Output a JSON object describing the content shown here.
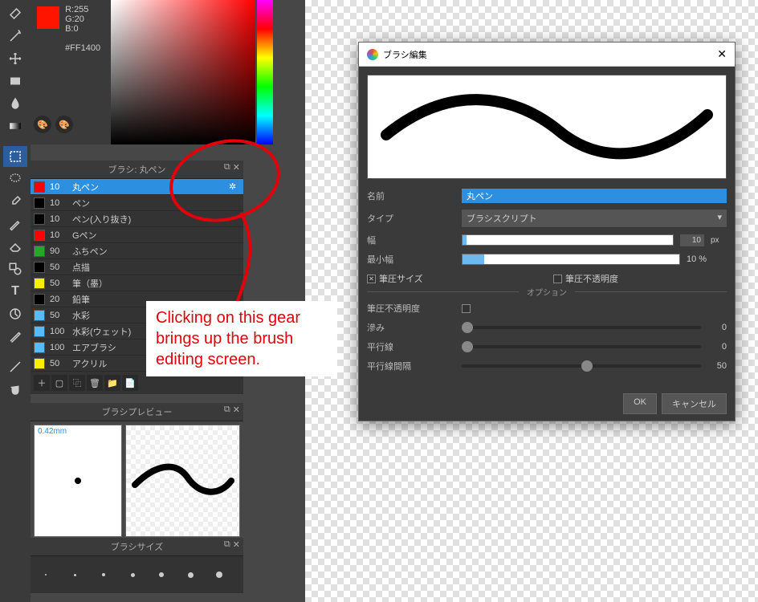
{
  "color": {
    "r": "R:255",
    "g": "G:20",
    "b": "B:0",
    "hex": "#FF1400"
  },
  "brush_panel": {
    "title": "ブラシ: 丸ペン",
    "items": [
      {
        "color": "#ff0000",
        "size": "10",
        "name": "丸ペン",
        "selected": true
      },
      {
        "color": "#000000",
        "size": "10",
        "name": "ペン"
      },
      {
        "color": "#000000",
        "size": "10",
        "name": "ペン(入り抜き)"
      },
      {
        "color": "#ff0000",
        "size": "10",
        "name": "Gペン"
      },
      {
        "color": "#22aa22",
        "size": "90",
        "name": "ふちペン"
      },
      {
        "color": "#000000",
        "size": "50",
        "name": "点描"
      },
      {
        "color": "#ffee00",
        "size": "50",
        "name": "筆（墨）"
      },
      {
        "color": "#000000",
        "size": "20",
        "name": "鉛筆"
      },
      {
        "color": "#55bbff",
        "size": "50",
        "name": "水彩"
      },
      {
        "color": "#55bbff",
        "size": "100",
        "name": "水彩(ウェット)"
      },
      {
        "color": "#55bbff",
        "size": "100",
        "name": "エアブラシ"
      },
      {
        "color": "#ffee00",
        "size": "50",
        "name": "アクリル"
      }
    ]
  },
  "preview_panel": {
    "title": "ブラシプレビュー",
    "mm": "0.42mm"
  },
  "size_panel": {
    "title": "ブラシサイズ"
  },
  "dialog": {
    "title": "ブラシ編集",
    "fields": {
      "name_label": "名前",
      "name_value": "丸ペン",
      "type_label": "タイプ",
      "type_value": "ブラシスクリプト",
      "width_label": "幅",
      "width_value": "10",
      "width_unit": "px",
      "minwidth_label": "最小幅",
      "minwidth_value": "10 %",
      "pressure_size": "筆圧サイズ",
      "pressure_opacity": "筆圧不透明度",
      "options_label": "オプション",
      "opt_pressure_opacity": "筆圧不透明度",
      "opt_bleed": "滲み",
      "opt_bleed_val": "0",
      "opt_parallel": "平行線",
      "opt_parallel_val": "0",
      "opt_spacing": "平行線間隔",
      "opt_spacing_val": "50"
    },
    "ok": "OK",
    "cancel": "キャンセル"
  },
  "annotation": "Clicking on this gear brings up the brush editing screen."
}
